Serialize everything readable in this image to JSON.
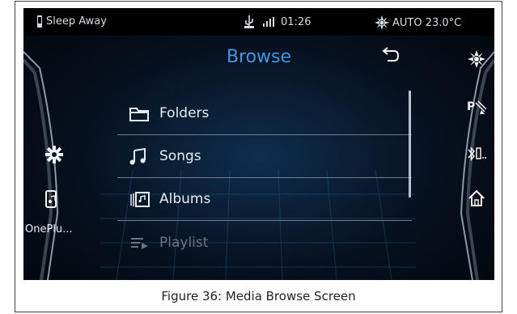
{
  "status": {
    "device": "Sleep Away",
    "time": "01:26",
    "climate": "AUTO 23.0°C"
  },
  "header": {
    "title": "Browse"
  },
  "list": [
    {
      "label": "Folders",
      "icon": "folder-icon"
    },
    {
      "label": "Songs",
      "icon": "music-note-icon"
    },
    {
      "label": "Albums",
      "icon": "album-icon"
    },
    {
      "label": "Playlist",
      "icon": "playlist-icon"
    }
  ],
  "left_panel": {
    "device_label": "OnePlu..."
  },
  "caption": "Figure 36: Media Browse Screen",
  "colors": {
    "accent": "#3f97e6",
    "text": "#e7edf3",
    "dim": "#6a7687",
    "bg": "#06101e"
  }
}
